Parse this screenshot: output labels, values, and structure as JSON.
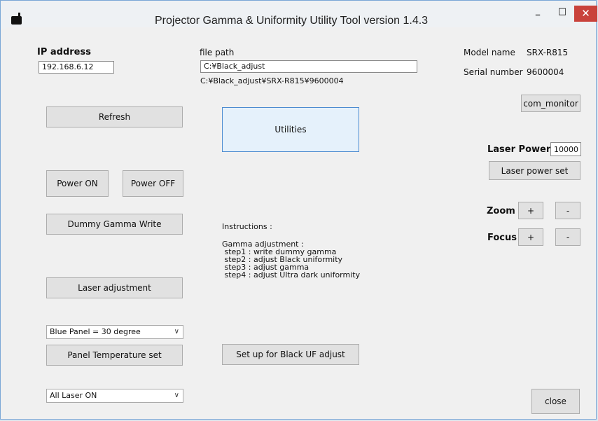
{
  "window": {
    "title": "Projector Gamma & Uniformity Utility Tool version 1.4.3",
    "minimize": "–",
    "maximize": "□",
    "close": "✕"
  },
  "left": {
    "ip_label": "IP address",
    "ip_value": "192.168.6.12",
    "refresh": "Refresh",
    "power_on": "Power ON",
    "power_off": "Power OFF",
    "dummy_gamma": "Dummy Gamma Write",
    "laser_adjust": "Laser adjustment",
    "panel_select": "Blue Panel = 30 degree",
    "panel_temp_set": "Panel Temperature set",
    "laser_select": "All Laser ON"
  },
  "center": {
    "file_path_label": "file path",
    "file_path_value": "C:¥Black_adjust",
    "path_info": "C:¥Black_adjust¥SRX-R815¥9600004",
    "utilities": "Utilities",
    "instructions_title": "Instructions :",
    "instructions_heading": "Gamma adjustment :",
    "steps": [
      " step1 : write dummy gamma",
      " step2 : adjust Black uniformity",
      " step3 : adjust gamma",
      " step4 : adjust Ultra dark uniformity"
    ],
    "setup_black_uf": "Set up for Black UF adjust"
  },
  "right": {
    "model_label": "Model name",
    "model_value": "SRX-R815",
    "serial_label": "Serial number",
    "serial_value": "9600004",
    "com_monitor": "com_monitor",
    "laser_power_label": "Laser Power",
    "laser_power_value": "10000",
    "laser_power_set": "Laser power set",
    "zoom_label": "Zoom",
    "focus_label": "Focus",
    "plus": "+",
    "minus": "-",
    "close": "close"
  }
}
